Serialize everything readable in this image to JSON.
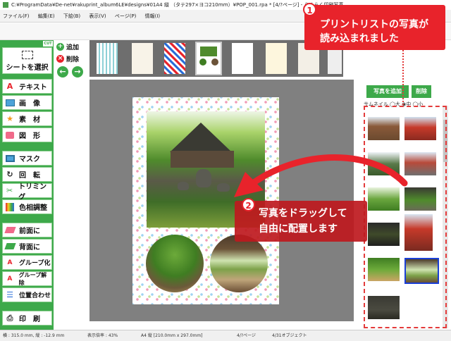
{
  "window": {
    "title": "C:¥ProgramData¥De-net¥rakuprint_album6LE¥designs¥01A4 縦 （タテ297×ヨコ210ｍｍ）¥POP_001.rpa * [4/?ページ] - らくらく印刷写真"
  },
  "menu": [
    "ファイル(F)",
    "編集(E)",
    "下絵(B)",
    "表示(V)",
    "ページ(P)",
    "情報(I)"
  ],
  "sidebar": {
    "cut_badge": "CUT",
    "sheet_select": "シートを選択",
    "tools": [
      {
        "label": "テキスト",
        "icon": "text-icon"
      },
      {
        "label": "画　像",
        "icon": "image-icon"
      },
      {
        "label": "素　材",
        "icon": "star-icon"
      },
      {
        "label": "図　形",
        "icon": "shape-icon"
      },
      {
        "label": "マスク",
        "icon": "mask-icon"
      },
      {
        "label": "回　転",
        "icon": "rotate-icon"
      },
      {
        "label": "トリミング",
        "icon": "scissors-icon"
      },
      {
        "label": "色相調整",
        "icon": "color-adjust-icon"
      },
      {
        "label": "前面に",
        "icon": "bring-front-icon"
      },
      {
        "label": "背面に",
        "icon": "send-back-icon"
      },
      {
        "label": "グループ化",
        "icon": "group-icon"
      },
      {
        "label": "グループ解除",
        "icon": "ungroup-icon"
      },
      {
        "label": "位置合わせ",
        "icon": "align-icon"
      },
      {
        "label": "印　刷",
        "icon": "printer-icon"
      }
    ]
  },
  "page_actions": {
    "add": "追加",
    "delete": "削除"
  },
  "right_panel": {
    "add_photo": "写真を追加",
    "delete": "削除",
    "view_label": "サムネイル ◯大 ◉中 ◯小"
  },
  "statusbar": {
    "coords": "横 : 315.0 mm, 縦 : -12.9 mm",
    "zoom": "表示倍率 : 43%",
    "paper": "A4 縦 [210.0mm x 297.0mm]",
    "page": "4/?ページ",
    "objects": "4/31オブジェクト"
  },
  "callouts": {
    "one_number": "1",
    "one_line1": "プリントリストの写真が",
    "one_line2": "読み込まれました",
    "two_number": "2",
    "two_line1": "写真をドラッグして",
    "two_line2": "自由に配置します"
  },
  "colors": {
    "accent_green": "#3da94a",
    "callout_red": "#e8232b",
    "selection_blue": "#1a3fd6"
  }
}
